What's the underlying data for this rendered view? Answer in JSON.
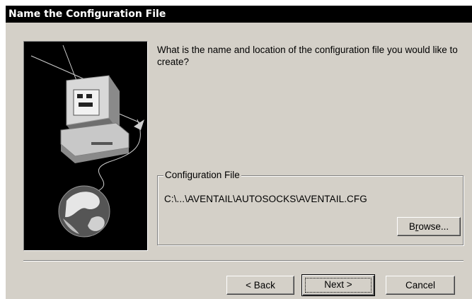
{
  "window": {
    "title": "Name the Configuration File"
  },
  "prompt": {
    "text": "What is the name and location of the configuration file you would like to create?"
  },
  "config_group": {
    "legend": "Configuration File",
    "path": "C:\\...\\AVENTAIL\\AUTOSOCKS\\AVENTAIL.CFG",
    "browse_label": "Browse...",
    "browse_mnemonic": "r"
  },
  "footer": {
    "back_label": "< Back",
    "next_label": "Next >",
    "cancel_label": "Cancel"
  },
  "illustration": {
    "icon": "computer-network-globe-icon",
    "background": "#000000"
  },
  "colors": {
    "dialog_bg": "#d4d0c8",
    "title_bg": "#000000",
    "title_fg": "#ffffff"
  }
}
